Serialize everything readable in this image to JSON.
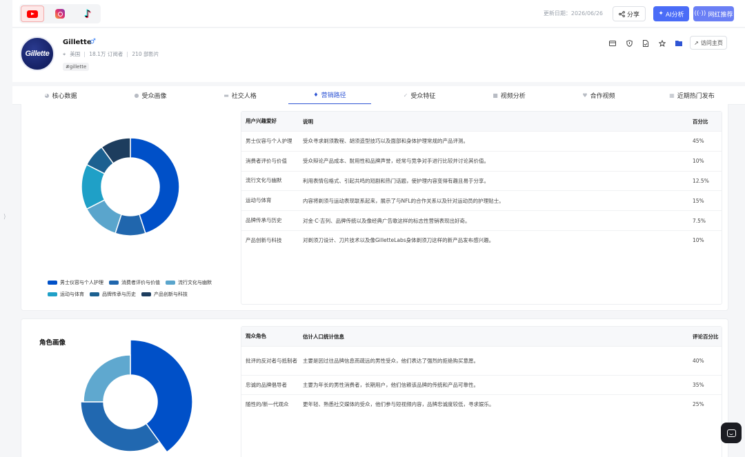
{
  "platforms": [
    {
      "name": "youtube-icon",
      "active": true
    },
    {
      "name": "instagram-icon",
      "active": false
    },
    {
      "name": "tiktok-icon",
      "active": false
    }
  ],
  "header": {
    "update_date": "更新日期：2026/06/26",
    "share_label": "分享",
    "ai_label": "AI分析",
    "recommend_label": "网红推荐"
  },
  "profile": {
    "logo_text": "Gillette",
    "name": "Gillette",
    "gender_symbol": "♂",
    "country": "美国",
    "subscribers": "18.1万 订阅者",
    "videos": "210 部影片",
    "tag": "#gillette",
    "visit_label": "访问主页"
  },
  "tabs": [
    {
      "label": "核心数据",
      "icon": "chart-icon"
    },
    {
      "label": "受众画像",
      "icon": "user-icon"
    },
    {
      "label": "社交人格",
      "icon": "chat-icon"
    },
    {
      "label": "营销路径",
      "icon": "location-icon",
      "active": true
    },
    {
      "label": "受众特征",
      "icon": "check-icon"
    },
    {
      "label": "视频分析",
      "icon": "video-icon"
    },
    {
      "label": "合作视频",
      "icon": "heart-icon"
    },
    {
      "label": "近期热门发布",
      "icon": "calendar-icon"
    }
  ],
  "interests_table": {
    "headers": [
      "用户兴趣爱好",
      "说明",
      "百分比"
    ],
    "rows": [
      [
        "男士仪容与个人护理",
        "受众寻求剃须教程、胡须造型技巧以及面部和身体护理常规的产品评测。",
        "45%"
      ],
      [
        "消费者评价与价值",
        "受众辩论产品成本、耐用性和品牌声誉，经常与竞争对手进行比较并讨论其价值。",
        "10%"
      ],
      [
        "流行文化与幽默",
        "利用表情包格式、引起共鸣的短剧和热门话题，使护理内容变得有趣且易于分享。",
        "12.5%"
      ],
      [
        "运动与体育",
        "内容将剃须与运动表现联系起来，展示了与NFL的合作关系以及针对运动员的护理贴士。",
        "15%"
      ],
      [
        "品牌传承与历史",
        "对金·C·吉列、品牌传统以及像经典广告歌这样的标志性营销表现出好奇。",
        "7.5%"
      ],
      [
        "产品创新与科技",
        "对剃须刀设计、刀片技术以及像GilletteLabs身体剃须刀这样的新产品发布感兴趣。",
        "10%"
      ]
    ]
  },
  "roles_section": {
    "title": "角色画像",
    "headers": [
      "观众角色",
      "估计人口统计信息",
      "评论百分比"
    ],
    "rows": [
      [
        "批评的反对者与抵制者",
        "主要是因过往品牌信息而疏远的男性受众，他们表达了强烈的拒绝购买意愿。",
        "40%"
      ],
      [
        "忠诚的品牌倡导者",
        "主要为年长的男性消费者，长期用户，他们信赖该品牌的传统和产品可靠性。",
        "35%"
      ],
      [
        "随性的/新一代观众",
        "更年轻、熟悉社交媒体的受众，他们参与短视频内容，品牌忠诚度较低，寻求娱乐。",
        "25%"
      ]
    ]
  },
  "chart_data": [
    {
      "type": "pie",
      "categories": [
        "男士仪容与个人护理",
        "消费者评价与价值",
        "流行文化与幽默",
        "运动与体育",
        "品牌传承与历史",
        "产品创新与科技"
      ],
      "values": [
        45,
        10,
        12.5,
        15,
        7.5,
        10
      ],
      "colors": [
        "#0050c8",
        "#2066ad",
        "#5aa5cc",
        "#1fa0c7",
        "#1c6090",
        "#1d3d5e"
      ],
      "donut": true,
      "legend_position": "bottom"
    },
    {
      "type": "pie",
      "categories": [
        "批评的反对者与抵制者",
        "忠诚的品牌倡导者",
        "随性的/新一代观众"
      ],
      "values": [
        40,
        35,
        25
      ],
      "colors": [
        "#0050c8",
        "#2168b0",
        "#5fa8cf"
      ],
      "donut": true
    }
  ]
}
